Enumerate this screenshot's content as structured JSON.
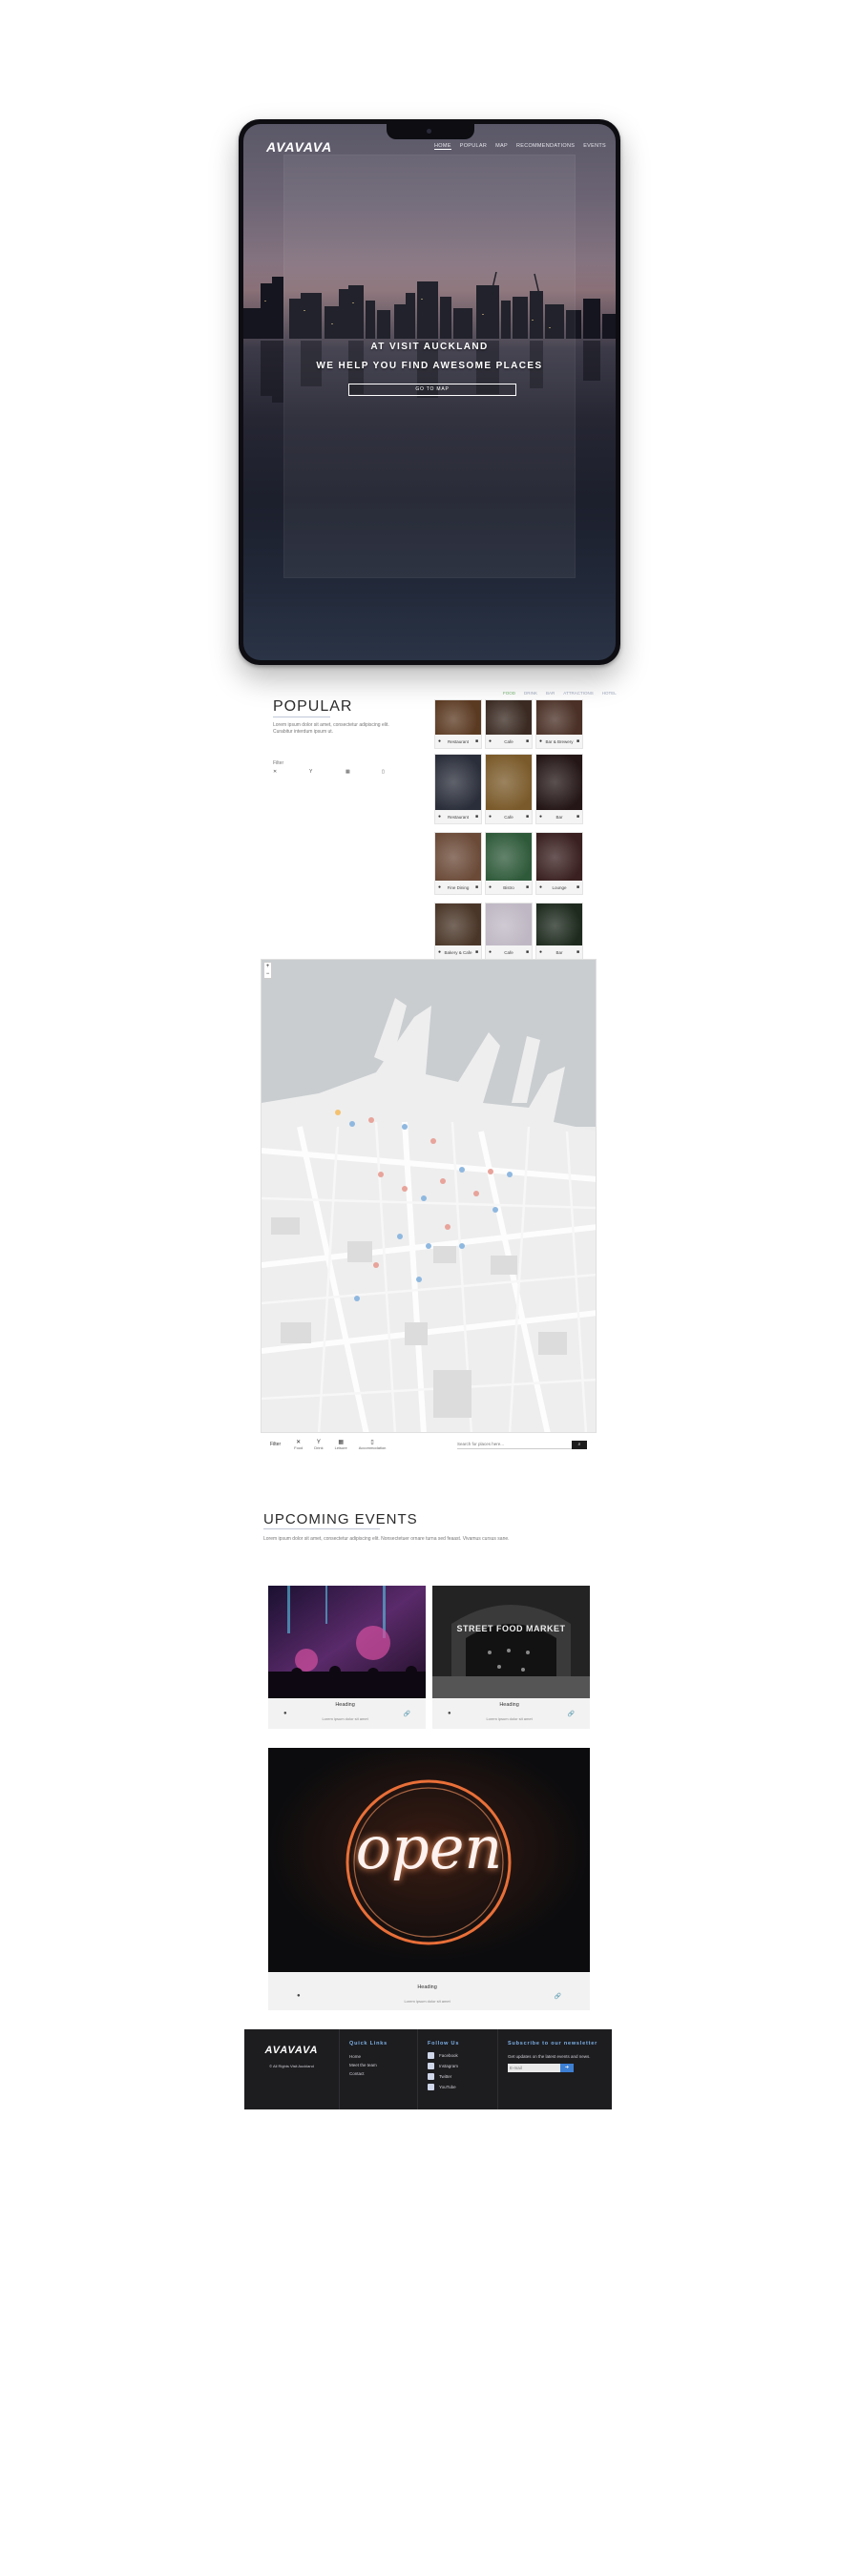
{
  "hero": {
    "logo": "AVAVAVA",
    "nav": [
      "HOME",
      "POPULAR",
      "MAP",
      "RECOMMENDATIONS",
      "EVENTS"
    ],
    "line1": "AT VISIT AUCKLAND",
    "line2": "WE HELP YOU FIND AWESOME PLACES",
    "button": "GO TO MAP"
  },
  "popular": {
    "title": "POPULAR",
    "text": "Lorem ipsum dolor sit amet, consectetur adipiscing elit. Curabitur interdum ipsum ut.",
    "filter_label": "Filter",
    "categories": [
      {
        "icon": "fork-knife-icon",
        "glyph": "✕"
      },
      {
        "icon": "cocktail-icon",
        "glyph": "Y"
      },
      {
        "icon": "museum-icon",
        "glyph": "▦"
      },
      {
        "icon": "hotel-icon",
        "glyph": "▯"
      }
    ],
    "grid_nav": [
      "FOOD",
      "DRINK",
      "BAR",
      "ATTRACTIONS",
      "HOTEL"
    ],
    "cards": [
      {
        "label": "Restaurant",
        "color": "#5b3a22"
      },
      {
        "label": "Cafe",
        "color": "#3a2a22"
      },
      {
        "label": "Bar & Brewery",
        "color": "#4a3026"
      },
      {
        "label": "Restaurant",
        "color": "#2a2e3a"
      },
      {
        "label": "Cafe",
        "color": "#7a5a2a"
      },
      {
        "label": "Bar",
        "color": "#241616"
      },
      {
        "label": "Fine Dining",
        "color": "#6b4a38"
      },
      {
        "label": "Bistro",
        "color": "#2f5a3a"
      },
      {
        "label": "Lounge",
        "color": "#3a2020"
      },
      {
        "label": "Bakery & Cafe",
        "color": "#4a3628"
      },
      {
        "label": "Cafe",
        "color": "#bfb8c4"
      },
      {
        "label": "Bar",
        "color": "#1e2a1e"
      }
    ]
  },
  "map": {
    "filter_label": "Filter",
    "filters": [
      {
        "icon": "fork-knife-icon",
        "glyph": "✕",
        "label": "Food"
      },
      {
        "icon": "cocktail-icon",
        "glyph": "Y",
        "label": "Drink"
      },
      {
        "icon": "museum-icon",
        "glyph": "▦",
        "label": "Leisure"
      },
      {
        "icon": "hotel-icon",
        "glyph": "▯",
        "label": "Accommodation"
      }
    ],
    "search_placeholder": "Search for places here...",
    "search_glyph": "⌕",
    "zoom_in": "+",
    "zoom_out": "−"
  },
  "events": {
    "title": "UPCOMING EVENTS",
    "text": "Lorem ipsum dolor sit amet, consectetur adipiscing elit. Nonsectetuer ornare turna sed feaast. Vivamus cursus sane.",
    "cards": [
      {
        "heading": "Heading",
        "sub": "Lorem ipsum dolor sit amet"
      },
      {
        "heading": "Heading",
        "sub": "Lorem ipsum dolor sit amet",
        "sign": "STREET FOOD MARKET"
      },
      {
        "heading": "Heading",
        "sub": "Lorem ipsum dolor sit amet",
        "sign": "open"
      }
    ]
  },
  "footer": {
    "logo": "AVAVAVA",
    "tagline": "© All Rights Visit Auckland",
    "links_title": "Quick Links",
    "links": [
      "Home",
      "Meet the team",
      "Contact"
    ],
    "follow_title": "Follow Us",
    "socials": [
      "Facebook",
      "Instagram",
      "Twitter",
      "YouTube"
    ],
    "subscribe_title": "Subscribe to our newsletter",
    "subscribe_text": "Get updates on the latest events and news.",
    "email_placeholder": "E-mail",
    "subscribe_glyph": "➜"
  }
}
